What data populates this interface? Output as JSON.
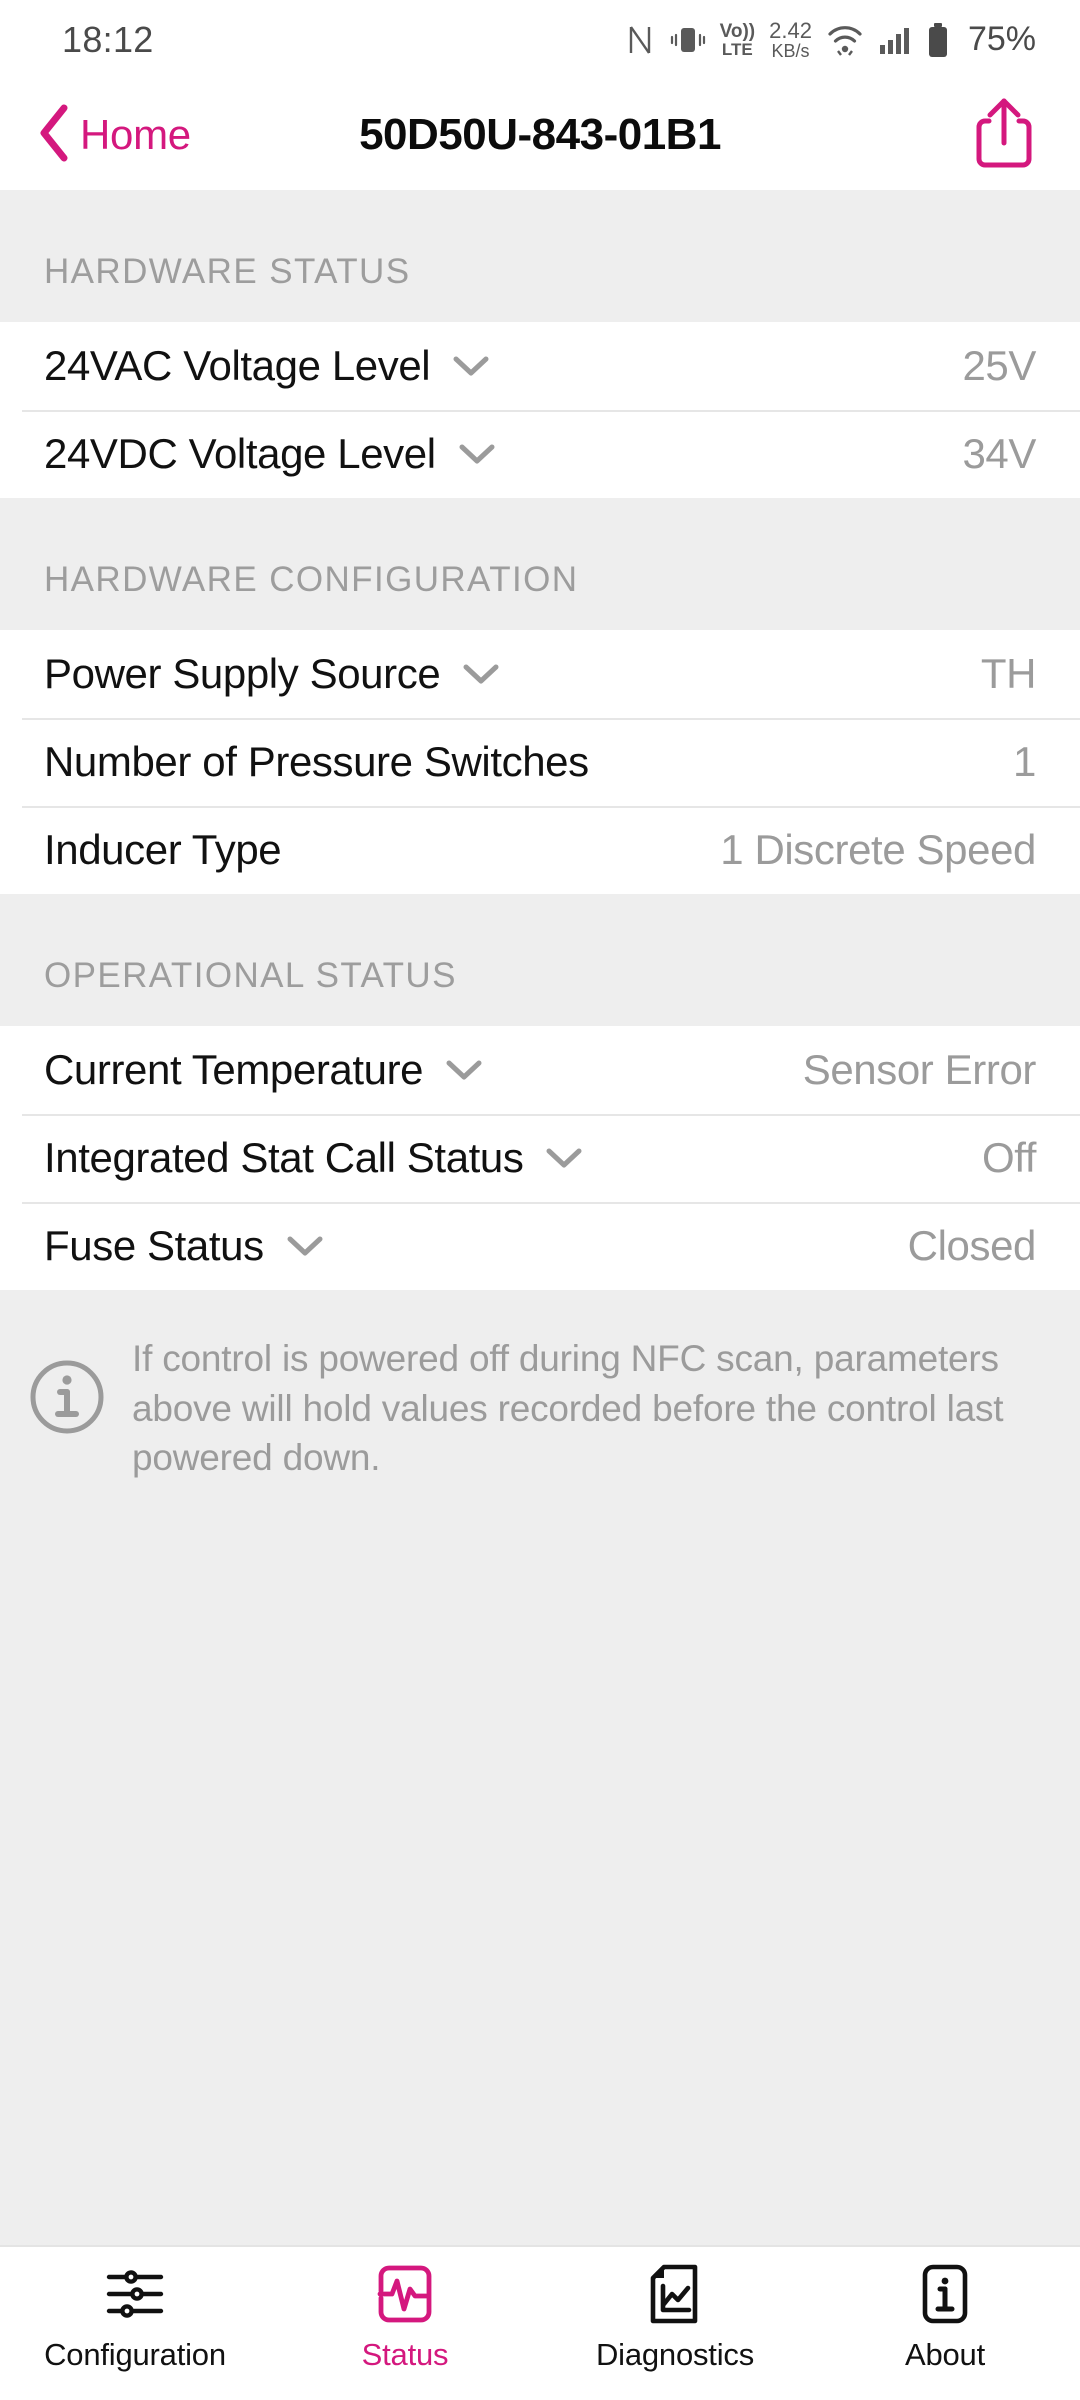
{
  "statusbar": {
    "time": "18:12",
    "nfc_icon": "nfc-icon",
    "vibrate_icon": "vibrate-icon",
    "volte_line1": "Vo))",
    "volte_line2": "LTE",
    "speed_value": "2.42",
    "speed_unit": "KB/s",
    "wifi_icon": "wifi-icon",
    "signal_icon": "cellular-signal-icon",
    "battery_icon": "battery-icon",
    "battery_percent": "75%"
  },
  "header": {
    "back_label": "Home",
    "back_icon": "chevron-left-icon",
    "title": "50D50U-843-01B1",
    "share_icon": "share-icon",
    "accent_color": "#D4187E"
  },
  "sections": [
    {
      "title": "HARDWARE STATUS",
      "rows": [
        {
          "label": "24VAC Voltage Level",
          "value": "25V",
          "expandable": true
        },
        {
          "label": "24VDC Voltage Level",
          "value": "34V",
          "expandable": true
        }
      ]
    },
    {
      "title": "HARDWARE CONFIGURATION",
      "rows": [
        {
          "label": "Power Supply Source",
          "value": "TH",
          "expandable": true
        },
        {
          "label": "Number of Pressure Switches",
          "value": "1",
          "expandable": false
        },
        {
          "label": "Inducer Type",
          "value": "1 Discrete Speed",
          "expandable": false
        }
      ]
    },
    {
      "title": "OPERATIONAL STATUS",
      "rows": [
        {
          "label": "Current Temperature",
          "value": "Sensor Error",
          "expandable": true
        },
        {
          "label": "Integrated Stat Call Status",
          "value": "Off",
          "expandable": true
        },
        {
          "label": "Fuse Status",
          "value": "Closed",
          "expandable": true
        }
      ]
    }
  ],
  "note": {
    "icon": "info-circle-icon",
    "text": "If control is powered off during NFC scan, parameters above will hold values recorded before the control last powered down."
  },
  "tabbar": {
    "items": [
      {
        "label": "Configuration",
        "icon": "sliders-icon",
        "active": false
      },
      {
        "label": "Status",
        "icon": "pulse-icon",
        "active": true
      },
      {
        "label": "Diagnostics",
        "icon": "document-chart-icon",
        "active": false
      },
      {
        "label": "About",
        "icon": "info-square-icon",
        "active": false
      }
    ],
    "active_color": "#D4187E",
    "inactive_color": "#111111"
  }
}
